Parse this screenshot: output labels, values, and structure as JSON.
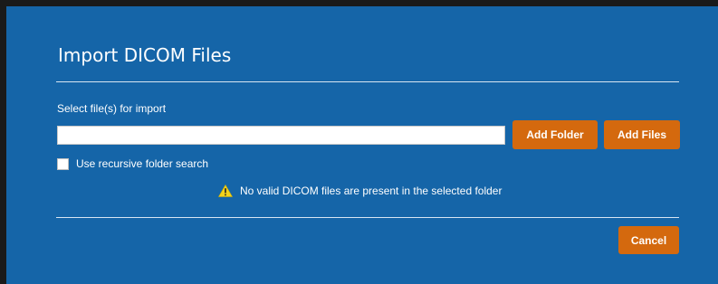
{
  "dialog": {
    "title": "Import DICOM Files",
    "select_label": "Select file(s) for import",
    "path_input": {
      "value": "",
      "placeholder": ""
    },
    "buttons": {
      "add_folder": "Add Folder",
      "add_files": "Add Files",
      "cancel": "Cancel"
    },
    "recursive_checkbox": {
      "label": "Use recursive folder search",
      "checked": false
    },
    "warning": {
      "icon": "warning-triangle-icon",
      "text": "No valid DICOM files are present in the selected folder"
    }
  },
  "colors": {
    "dialog_background": "#1565a8",
    "button_accent": "#d4690e",
    "warning_icon": "#f2d21b",
    "text": "#ffffff"
  }
}
